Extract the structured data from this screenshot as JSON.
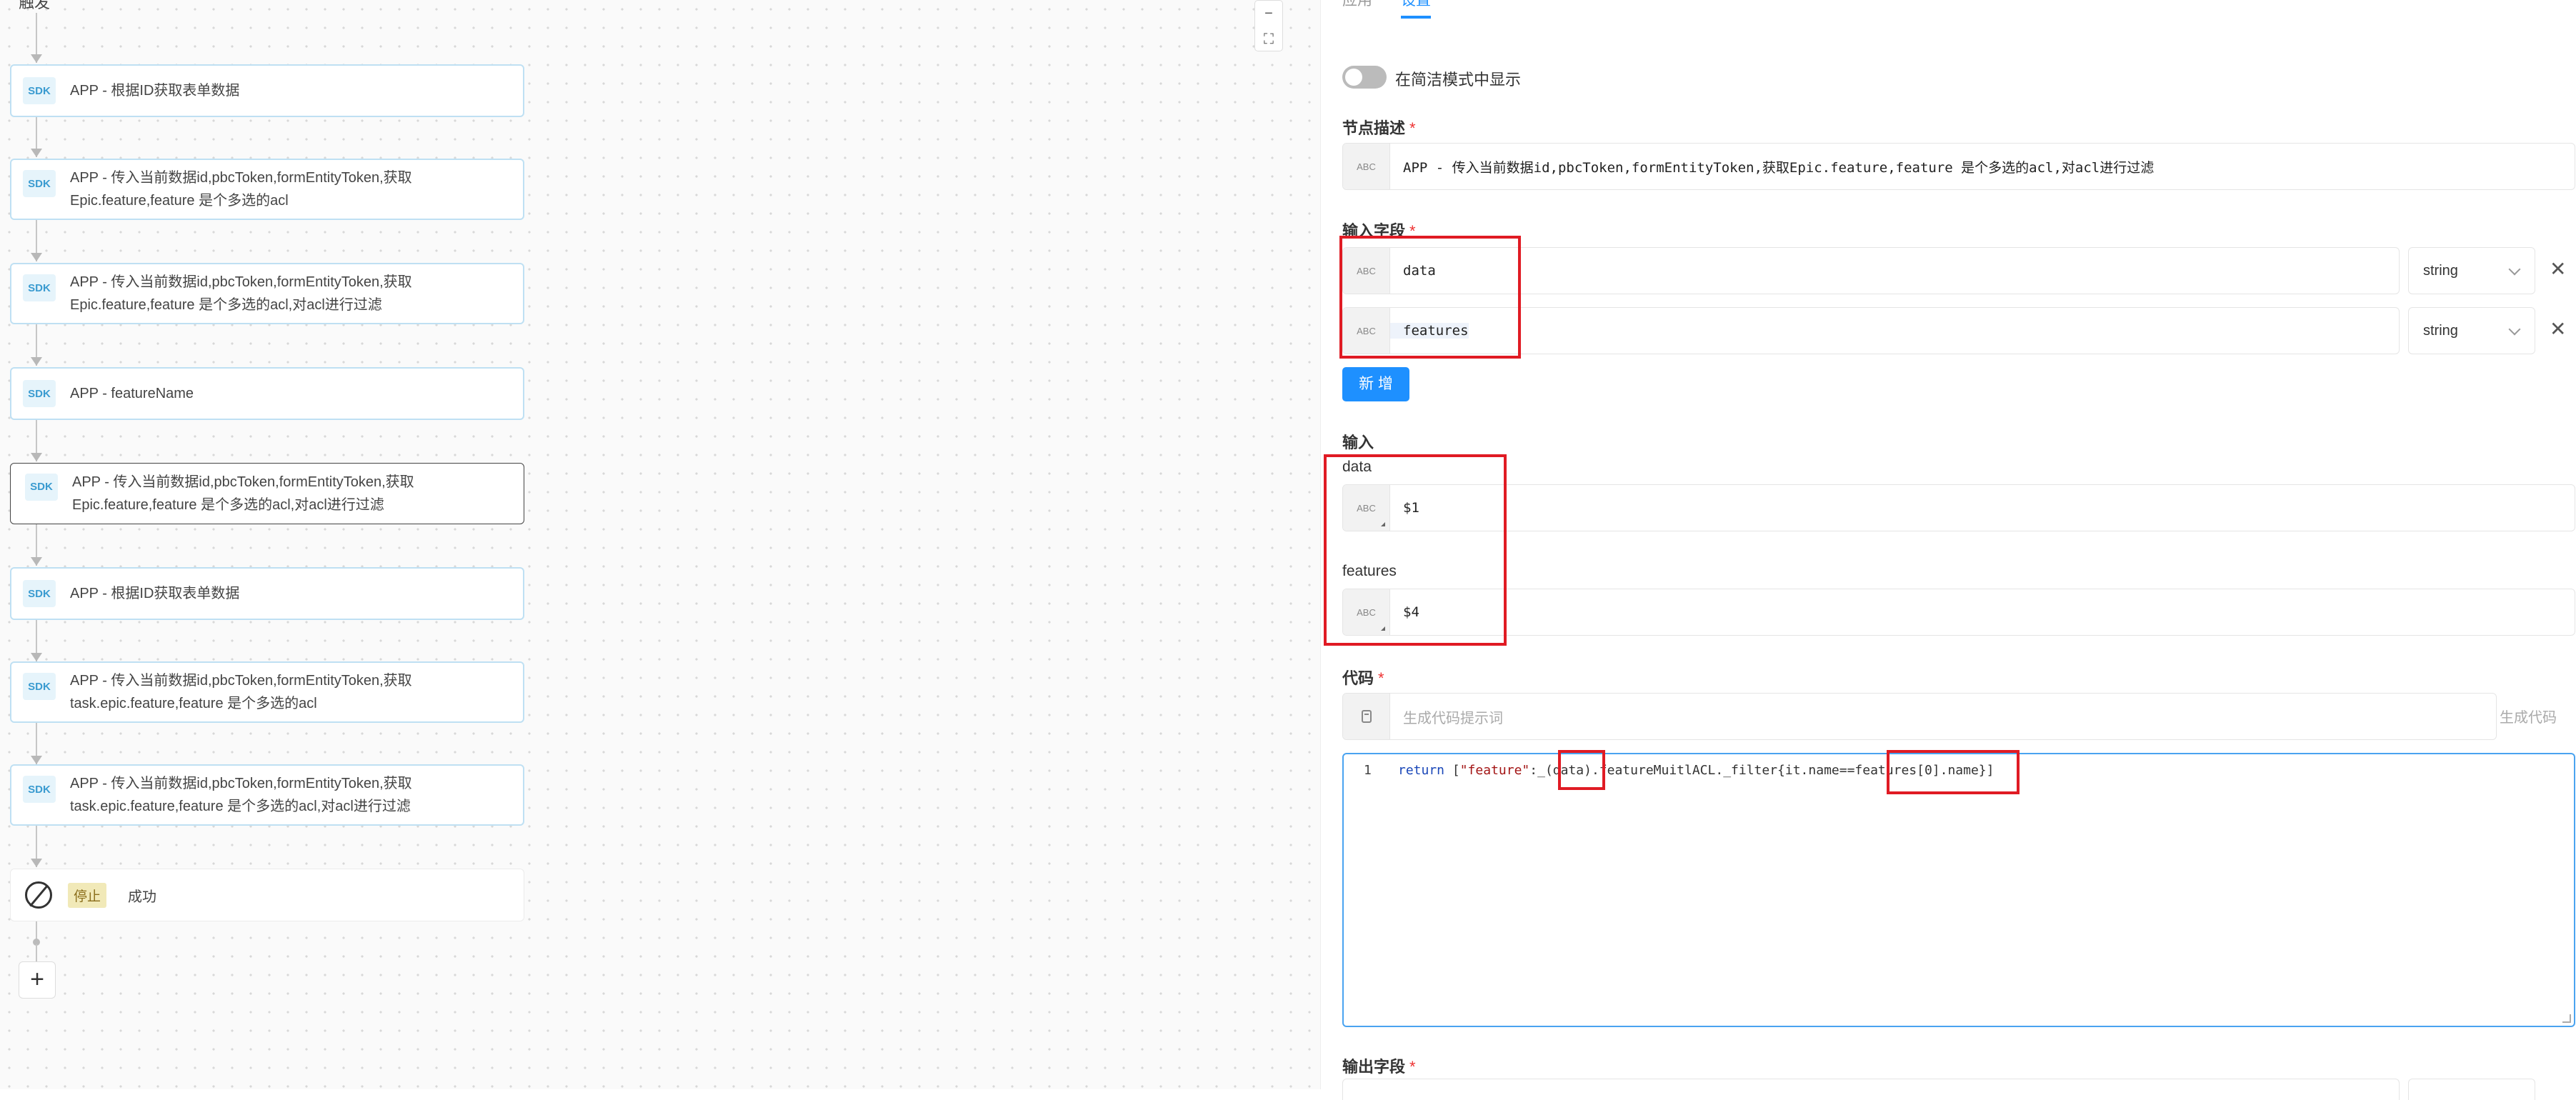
{
  "canvas": {
    "trigger_label": "触发",
    "nodes": [
      {
        "badge": "SDK",
        "text": "APP - 根据ID获取表单数据"
      },
      {
        "badge": "SDK",
        "text": "APP - 传入当前数据id,pbcToken,formEntityToken,获取\nEpic.feature,feature 是个多选的acl"
      },
      {
        "badge": "SDK",
        "text": "APP - 传入当前数据id,pbcToken,formEntityToken,获取\nEpic.feature,feature 是个多选的acl,对acl进行过滤"
      },
      {
        "badge": "SDK",
        "text": "APP - featureName"
      },
      {
        "badge": "SDK",
        "text": "APP - 传入当前数据id,pbcToken,formEntityToken,获取\nEpic.feature,feature 是个多选的acl,对acl进行过滤"
      },
      {
        "badge": "SDK",
        "text": "APP - 根据ID获取表单数据"
      },
      {
        "badge": "SDK",
        "text": "APP - 传入当前数据id,pbcToken,formEntityToken,获取\ntask.epic.feature,feature 是个多选的acl"
      },
      {
        "badge": "SDK",
        "text": "APP - 传入当前数据id,pbcToken,formEntityToken,获取\ntask.epic.feature,feature 是个多选的acl,对acl进行过滤"
      }
    ],
    "stop": {
      "tag": "停止",
      "text": "成功"
    },
    "add_label": "+",
    "zoom_out": "−",
    "fullscreen": "⛶"
  },
  "panel": {
    "tabs": [
      "应用",
      "设置"
    ],
    "simple_mode_label": "在简洁模式中显示",
    "node_desc": {
      "label": "节点描述",
      "type_tag": "ABC",
      "value": "APP - 传入当前数据id,pbcToken,formEntityToken,获取Epic.feature,feature 是个多选的acl,对acl进行过滤"
    },
    "input_fields": {
      "label": "输入字段",
      "rows": [
        {
          "type_tag": "ABC",
          "name": "data",
          "type": "string"
        },
        {
          "type_tag": "ABC",
          "name": "features",
          "type": "string"
        }
      ],
      "remove_icon": "✕",
      "add_button": "新 增"
    },
    "inputs": {
      "label": "输入",
      "items": [
        {
          "name": "data",
          "type_tag": "ABC",
          "value": "$1"
        },
        {
          "name": "features",
          "type_tag": "ABC",
          "value": "$4"
        }
      ]
    },
    "code": {
      "label": "代码",
      "prompt_placeholder": "生成代码提示词",
      "generate_label": "生成代码",
      "line_number": "1",
      "tokens": [
        {
          "t": "return",
          "c": "kw"
        },
        {
          "t": " [",
          "c": ""
        },
        {
          "t": "\"feature\"",
          "c": "str"
        },
        {
          "t": ":_(data).featureMuitlACL._filter{it.name==features[0].name}]",
          "c": ""
        }
      ]
    },
    "output_fields": {
      "label": "输出字段"
    }
  }
}
